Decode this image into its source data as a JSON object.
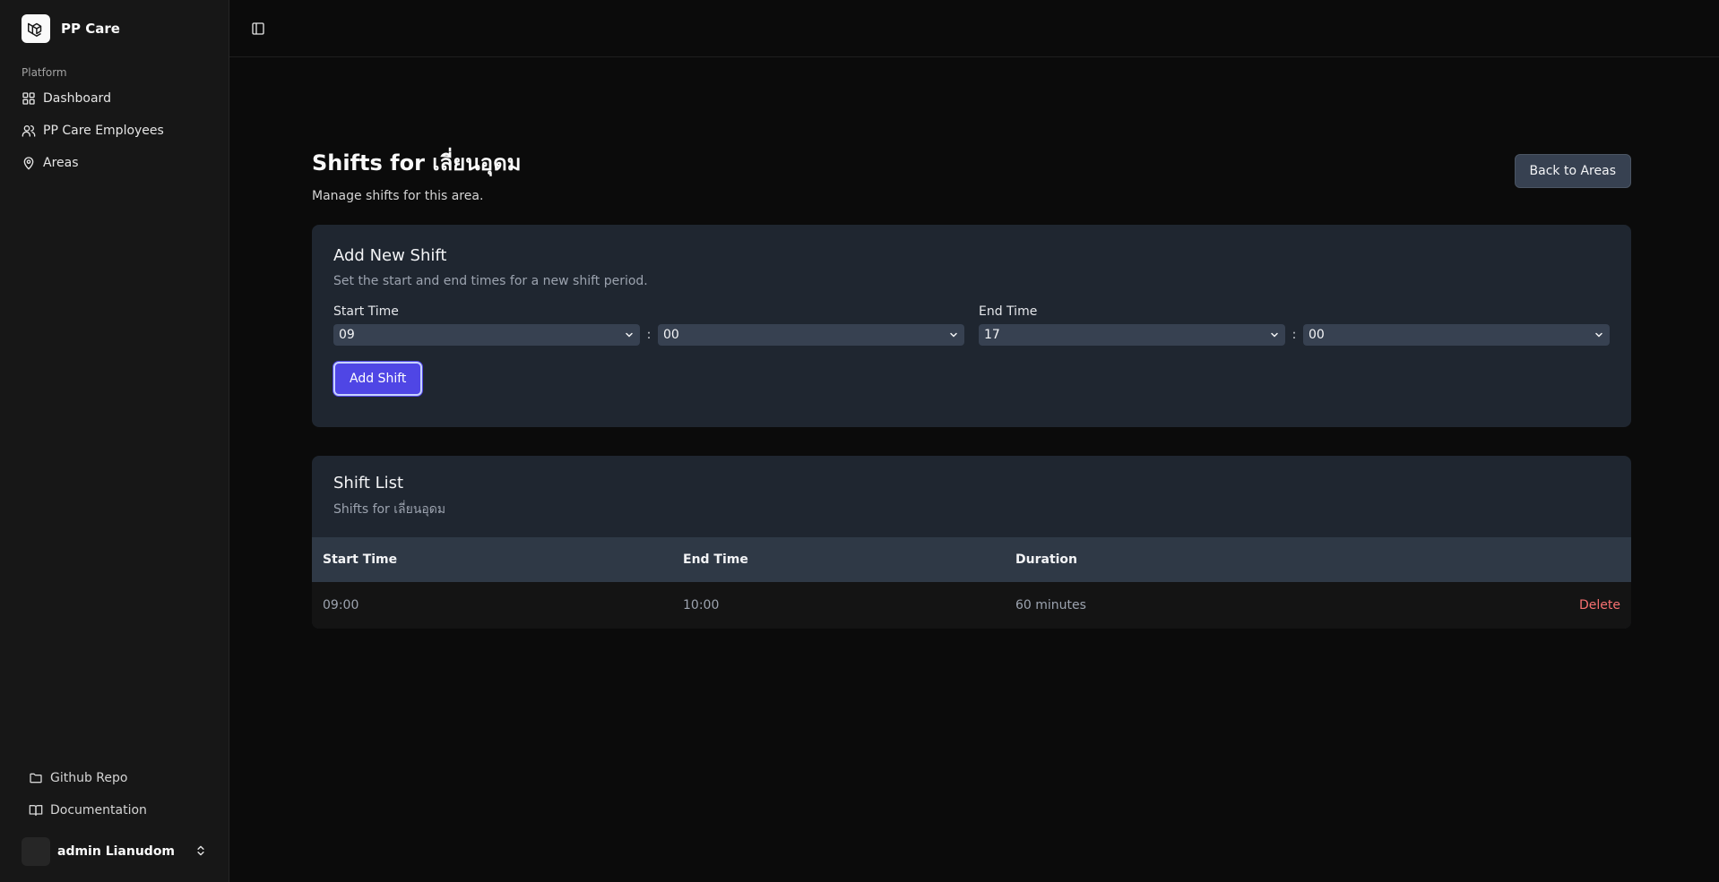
{
  "app": {
    "name": "PP Care"
  },
  "sidebar": {
    "group_label": "Platform",
    "items": [
      {
        "label": "Dashboard",
        "icon": "grid-icon"
      },
      {
        "label": "PP Care Employees",
        "icon": "users-icon"
      },
      {
        "label": "Areas",
        "icon": "map-pin-icon"
      }
    ],
    "bottom_items": [
      {
        "label": "Github Repo",
        "icon": "folder-icon"
      },
      {
        "label": "Documentation",
        "icon": "book-icon"
      }
    ],
    "user": {
      "name": "admin Lianudom"
    }
  },
  "page": {
    "title": "Shifts for เลี่ยนอุดม",
    "subtitle": "Manage shifts for this area.",
    "back_button": "Back to Areas"
  },
  "add_shift": {
    "title": "Add New Shift",
    "description": "Set the start and end times for a new shift period.",
    "start_label": "Start Time",
    "start_hour": "09",
    "start_minute": "00",
    "end_label": "End Time",
    "end_hour": "17",
    "end_minute": "00",
    "separator": ":",
    "submit_label": "Add Shift"
  },
  "shift_list": {
    "title": "Shift List",
    "subtitle": "Shifts for เลี่ยนอุดม",
    "columns": [
      "Start Time",
      "End Time",
      "Duration"
    ],
    "rows": [
      {
        "start": "09:00",
        "end": "10:00",
        "duration": "60 minutes",
        "action": "Delete"
      }
    ]
  },
  "colors": {
    "accent": "#4f46e5",
    "danger": "#f87171",
    "card": "#1f2630"
  }
}
